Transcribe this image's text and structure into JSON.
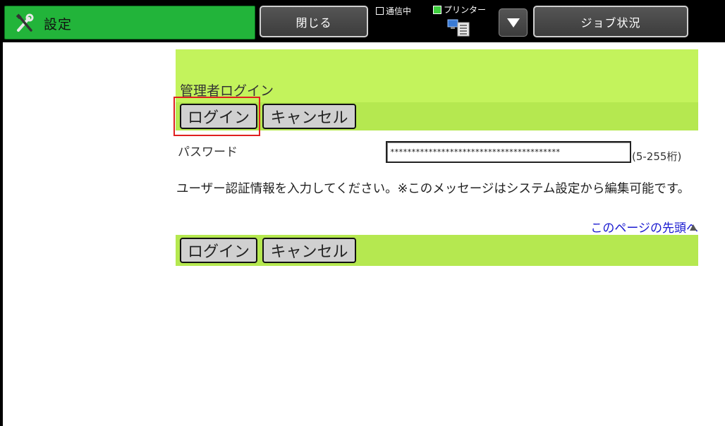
{
  "header": {
    "title": "設定",
    "close_label": "閉じる",
    "job_status_label": "ジョブ状況",
    "status_comm": "通信中",
    "status_printer": "プリンター"
  },
  "admin_login": {
    "title": "管理者ログイン",
    "login_label": "ログイン",
    "cancel_label": "キャンセル",
    "password_label": "パスワード",
    "password_value": "****************************************",
    "password_range": "(5-255桁)",
    "message": "ユーザー認証情報を入力してください。※このメッセージはシステム設定から編集可能です。",
    "page_top_link": "このページの先頭へ"
  },
  "colors": {
    "title_green": "#22b43a",
    "panel_green": "#c3f35c",
    "band_green": "#b5e850",
    "focus_red": "#e02020",
    "link_blue": "#1a1ad0"
  },
  "icons": [
    "tools-icon",
    "printer-icon",
    "dropdown-arrow-icon",
    "up-arrow-icon"
  ]
}
